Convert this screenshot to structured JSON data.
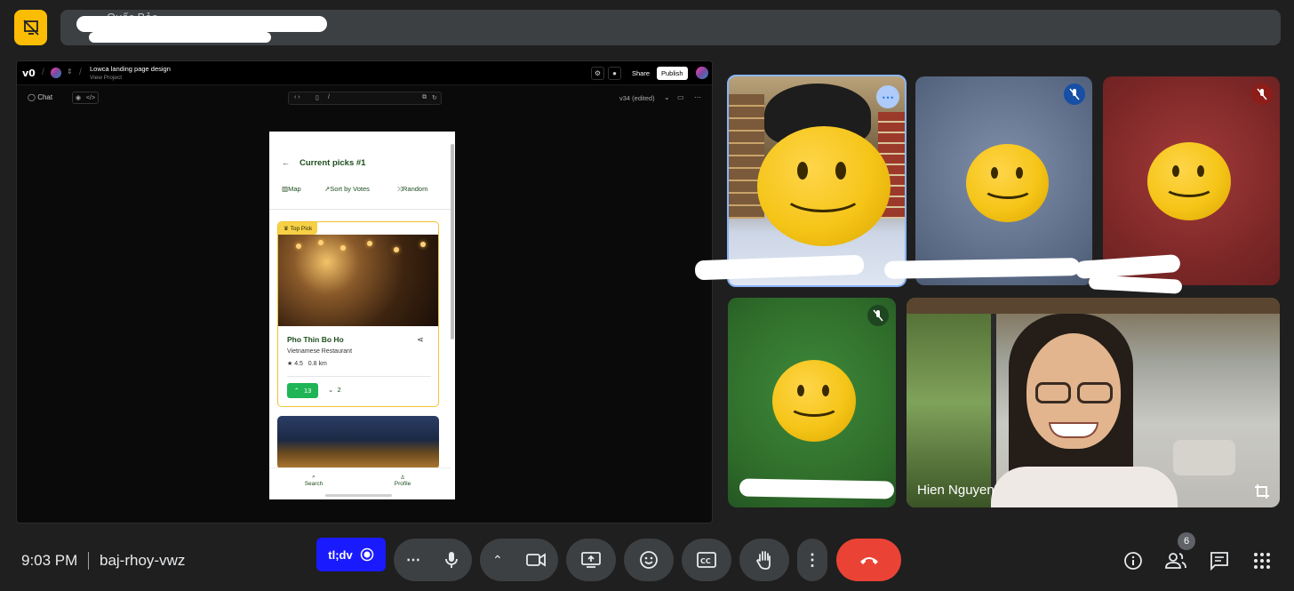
{
  "presenter": {
    "name": "Quốc Bảo"
  },
  "v0": {
    "logo": "v0",
    "project_title": "Lowca landing page design",
    "project_sub": "View Project",
    "share_label": "Share",
    "publish_label": "Publish",
    "chat_label": "Chat",
    "url_path": "/",
    "version": "v34 (edited)"
  },
  "phone": {
    "title": "Current picks #1",
    "tabs": [
      "Map",
      "Sort by Votes",
      "Random"
    ],
    "card": {
      "badge": "Top Pick",
      "name": "Pho Thin Bo Ho",
      "type": "Vietnamese Restaurant",
      "rating": "★ 4.5",
      "distance": "0.8 km",
      "upvotes": "13",
      "downvotes": "2"
    },
    "nav": [
      "Search",
      "Profile"
    ]
  },
  "tiles": {
    "participant_named": "Hien Nguyen"
  },
  "bottom": {
    "time": "9:03 PM",
    "meeting_code": "baj-rhoy-vwz",
    "tldv_label": "tl;dv",
    "people_count": "6"
  }
}
